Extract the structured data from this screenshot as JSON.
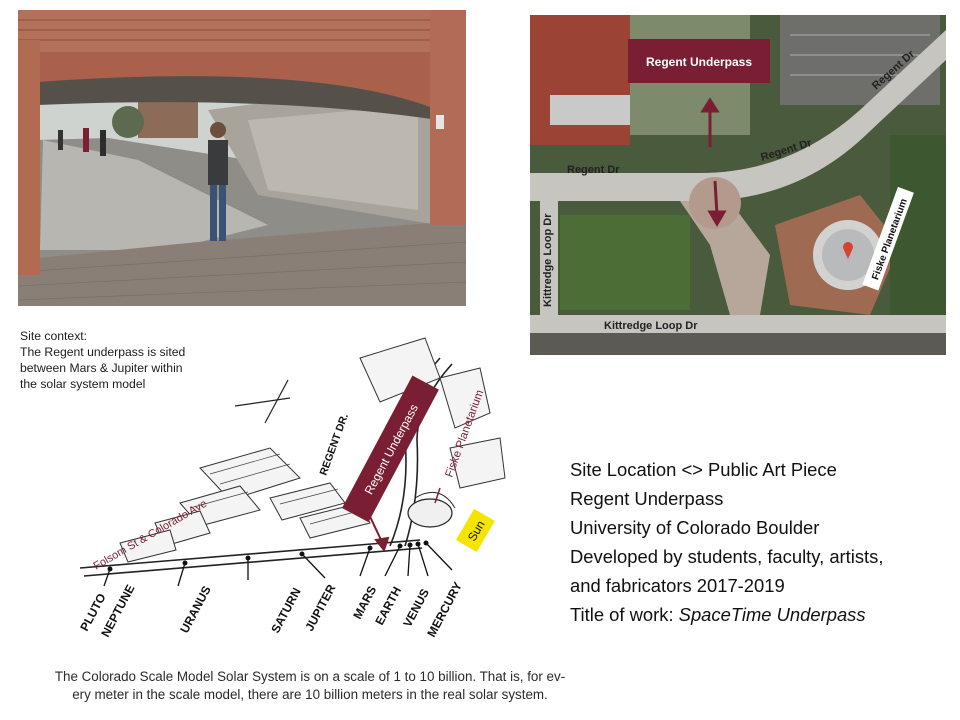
{
  "photo": {
    "alt_icon": "underpass-photo"
  },
  "aerial": {
    "regent_underpass": "Regent Underpass",
    "regent_dr_1": "Regent Dr",
    "regent_dr_2": "Regent Dr",
    "regent_dr_3": "Regent Dr",
    "kittredge_left": "Kittredge Loop Dr",
    "kittredge_bottom": "Kittredge Loop Dr",
    "fiske": "Fiske Planetarium",
    "marker_icon": "map-pin-icon"
  },
  "context": {
    "line1": "Site context:",
    "line2": "The Regent underpass is sited",
    "line3": "between Mars & Jupiter within",
    "line4": "the solar system model"
  },
  "sketch": {
    "regent_underpass": "Regent Underpass",
    "fiske": "Fiske Planetarium",
    "regent_dr": "REGENT DR.",
    "folsom": "Folsom St & Colorado Ave",
    "sun": "Sun",
    "planets": {
      "pluto": "PLUTO",
      "neptune": "NEPTUNE",
      "uranus": "URANUS",
      "saturn": "SATURN",
      "jupiter": "JUPITER",
      "mars": "MARS",
      "earth": "EARTH",
      "venus": "VENUS",
      "mercury": "MERCURY"
    }
  },
  "caption": {
    "line1": "The Colorado Scale Model Solar System is on a scale of 1 to 10 billion. That is, for ev-",
    "line2": "ery meter in the scale model, there are 10 billion meters in the real solar system."
  },
  "info": {
    "line1": "Site Location <> Public Art Piece",
    "line2": "Regent Underpass",
    "line3": "University of Colorado Boulder",
    "line4": "Developed by students, faculty, artists,",
    "line5": "and fabricators 2017-2019",
    "line6_prefix": "Title of work: ",
    "line6_title": "SpaceTime Underpass"
  },
  "colors": {
    "maroon": "#7a1f33",
    "sun_yellow": "#f5e400",
    "brick": "#b86a50"
  }
}
